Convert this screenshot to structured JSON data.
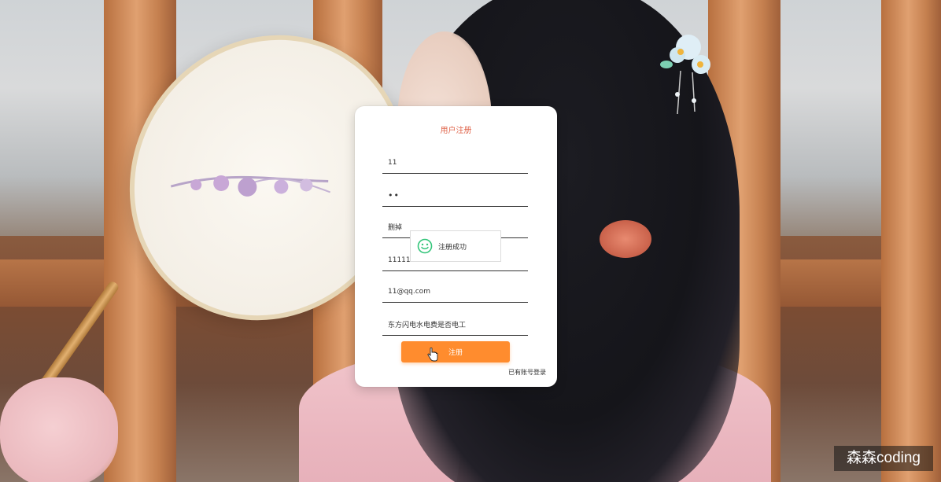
{
  "form": {
    "title": "用户注册",
    "fields": [
      {
        "name": "username",
        "value": "11"
      },
      {
        "name": "password",
        "value": "••"
      },
      {
        "name": "nickname",
        "value": "删掉"
      },
      {
        "name": "phone",
        "value": "11111"
      },
      {
        "name": "email",
        "value": "11@qq.com"
      },
      {
        "name": "address",
        "value": "东方闪电水电费是否电工"
      }
    ],
    "submit_label": "注册",
    "login_link": "已有账号登录"
  },
  "toast": {
    "message": "注册成功",
    "icon": "smile-icon",
    "color": "#34c57a"
  },
  "watermark": "森森coding",
  "colors": {
    "title": "#e0664c",
    "button": "#ff8c2e"
  }
}
